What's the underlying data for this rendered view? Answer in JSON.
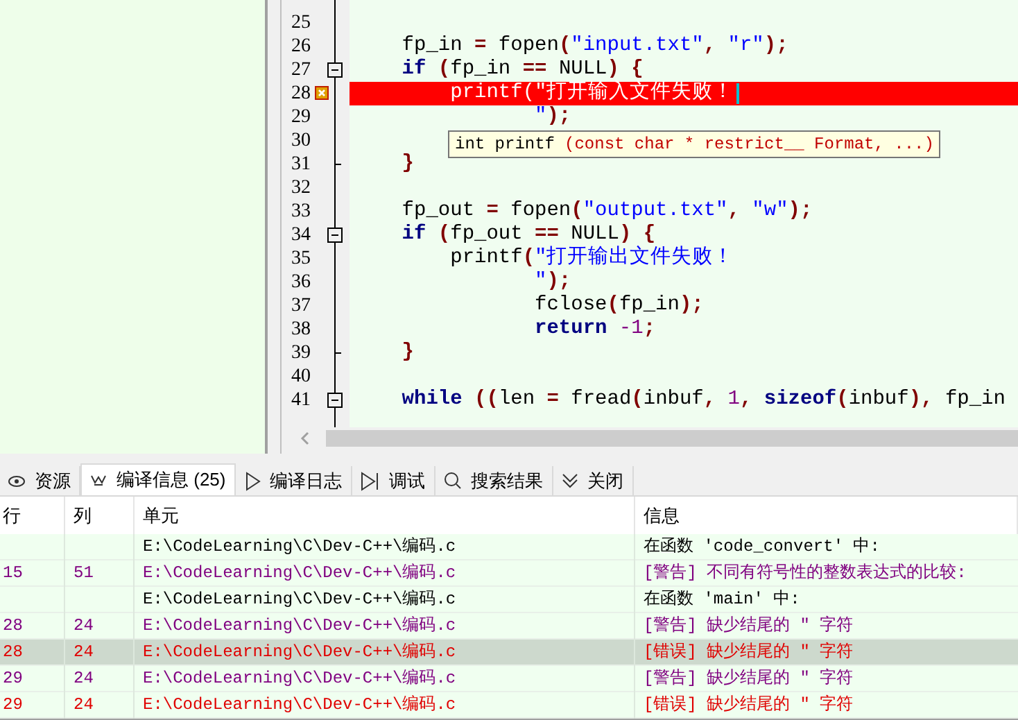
{
  "editor": {
    "lines": [
      {
        "number": "25"
      },
      {
        "number": "26",
        "segments": [
          {
            "kind": "txt",
            "t": "    fp_in "
          },
          {
            "kind": "sym",
            "t": "="
          },
          {
            "kind": "txt",
            "t": " fopen"
          },
          {
            "kind": "sym",
            "t": "("
          },
          {
            "kind": "str",
            "t": "\"input.txt\""
          },
          {
            "kind": "sym",
            "t": ","
          },
          {
            "kind": "str",
            "t": " \"r\""
          },
          {
            "kind": "sym",
            "t": ");"
          }
        ]
      },
      {
        "number": "27",
        "collapsible": true,
        "segments": [
          {
            "kind": "kw",
            "t": "    if"
          },
          {
            "kind": "sym",
            "t": " ("
          },
          {
            "kind": "txt",
            "t": "fp_in "
          },
          {
            "kind": "sym",
            "t": "=="
          },
          {
            "kind": "txt",
            "t": " NULL"
          },
          {
            "kind": "sym",
            "t": ") {"
          }
        ]
      },
      {
        "number": "28",
        "error": true,
        "cursor": true,
        "segments": [
          {
            "kind": "txt",
            "t": "        printf"
          },
          {
            "kind": "sym",
            "t": "("
          },
          {
            "kind": "str",
            "t": "\"打开输入文件失败！"
          }
        ]
      },
      {
        "number": "29",
        "segments": [
          {
            "kind": "str",
            "t": "               \""
          },
          {
            "kind": "sym",
            "t": ");"
          }
        ]
      },
      {
        "number": "30"
      },
      {
        "number": "31",
        "block_end": true,
        "segments": [
          {
            "kind": "sym",
            "t": "    }"
          }
        ]
      },
      {
        "number": "32"
      },
      {
        "number": "33",
        "segments": [
          {
            "kind": "txt",
            "t": "    fp_out "
          },
          {
            "kind": "sym",
            "t": "="
          },
          {
            "kind": "txt",
            "t": " fopen"
          },
          {
            "kind": "sym",
            "t": "("
          },
          {
            "kind": "str",
            "t": "\"output.txt\""
          },
          {
            "kind": "sym",
            "t": ","
          },
          {
            "kind": "str",
            "t": " \"w\""
          },
          {
            "kind": "sym",
            "t": ");"
          }
        ]
      },
      {
        "number": "34",
        "collapsible": true,
        "segments": [
          {
            "kind": "kw",
            "t": "    if"
          },
          {
            "kind": "sym",
            "t": " ("
          },
          {
            "kind": "txt",
            "t": "fp_out "
          },
          {
            "kind": "sym",
            "t": "=="
          },
          {
            "kind": "txt",
            "t": " NULL"
          },
          {
            "kind": "sym",
            "t": ") {"
          }
        ]
      },
      {
        "number": "35",
        "segments": [
          {
            "kind": "txt",
            "t": "        printf"
          },
          {
            "kind": "sym",
            "t": "("
          },
          {
            "kind": "str",
            "t": "\"打开输出文件失败！"
          }
        ]
      },
      {
        "number": "36",
        "segments": [
          {
            "kind": "str",
            "t": "               \""
          },
          {
            "kind": "sym",
            "t": ");"
          }
        ]
      },
      {
        "number": "37",
        "segments": [
          {
            "kind": "txt",
            "t": "               fclose"
          },
          {
            "kind": "sym",
            "t": "("
          },
          {
            "kind": "txt",
            "t": "fp_in"
          },
          {
            "kind": "sym",
            "t": ");"
          }
        ]
      },
      {
        "number": "38",
        "segments": [
          {
            "kind": "kw",
            "t": "               return"
          },
          {
            "kind": "num",
            "t": " -1"
          },
          {
            "kind": "sym",
            "t": ";"
          }
        ]
      },
      {
        "number": "39",
        "block_end": true,
        "segments": [
          {
            "kind": "sym",
            "t": "    }"
          }
        ]
      },
      {
        "number": "40"
      },
      {
        "number": "41",
        "collapsible": true,
        "segments": [
          {
            "kind": "kw",
            "t": "    while"
          },
          {
            "kind": "sym",
            "t": " (("
          },
          {
            "kind": "txt",
            "t": "len "
          },
          {
            "kind": "sym",
            "t": "="
          },
          {
            "kind": "txt",
            "t": " fread"
          },
          {
            "kind": "sym",
            "t": "("
          },
          {
            "kind": "txt",
            "t": "inbuf"
          },
          {
            "kind": "sym",
            "t": ","
          },
          {
            "kind": "num",
            "t": " 1"
          },
          {
            "kind": "sym",
            "t": ","
          },
          {
            "kind": "kw",
            "t": " sizeof"
          },
          {
            "kind": "sym",
            "t": "("
          },
          {
            "kind": "txt",
            "t": "inbuf"
          },
          {
            "kind": "sym",
            "t": "),"
          },
          {
            "kind": "txt",
            "t": " fp_in"
          }
        ]
      }
    ],
    "tooltip": {
      "signature": "int printf",
      "params": "(const char * restrict__ Format, ...)"
    }
  },
  "tabs": [
    {
      "kind": "eye",
      "label": "资源",
      "selected": false
    },
    {
      "kind": "crown",
      "label": "编译信息 (25)",
      "selected": true
    },
    {
      "kind": "play",
      "label": "编译日志",
      "selected": false
    },
    {
      "kind": "step",
      "label": "调试",
      "selected": false
    },
    {
      "kind": "search",
      "label": "搜索结果",
      "selected": false
    },
    {
      "kind": "chevrons",
      "label": "关闭",
      "selected": false
    }
  ],
  "table": {
    "columns": [
      "行",
      "列",
      "单元",
      "信息"
    ],
    "rows": [
      {
        "kind": "info",
        "unit": "E:\\CodeLearning\\C\\Dev-C++\\编码.c",
        "message": "在函数 'code_convert' 中:",
        "selected": false
      },
      {
        "kind": "warning",
        "line": "15",
        "col": "51",
        "unit": "E:\\CodeLearning\\C\\Dev-C++\\编码.c",
        "message": "[警告] 不同有符号性的整数表达式的比较:",
        "selected": false
      },
      {
        "kind": "info",
        "unit": "E:\\CodeLearning\\C\\Dev-C++\\编码.c",
        "message": "在函数 'main' 中:",
        "selected": false
      },
      {
        "kind": "warning",
        "line": "28",
        "col": "24",
        "unit": "E:\\CodeLearning\\C\\Dev-C++\\编码.c",
        "message": "[警告] 缺少结尾的 \" 字符",
        "selected": false
      },
      {
        "kind": "error",
        "line": "28",
        "col": "24",
        "unit": "E:\\CodeLearning\\C\\Dev-C++\\编码.c",
        "message": "[错误] 缺少结尾的 \" 字符",
        "selected": true
      },
      {
        "kind": "warning",
        "line": "29",
        "col": "24",
        "unit": "E:\\CodeLearning\\C\\Dev-C++\\编码.c",
        "message": "[警告] 缺少结尾的 \" 字符",
        "selected": false
      },
      {
        "kind": "error",
        "line": "29",
        "col": "24",
        "unit": "E:\\CodeLearning\\C\\Dev-C++\\编码.c",
        "message": "[错误] 缺少结尾的 \" 字符",
        "selected": false
      }
    ]
  }
}
